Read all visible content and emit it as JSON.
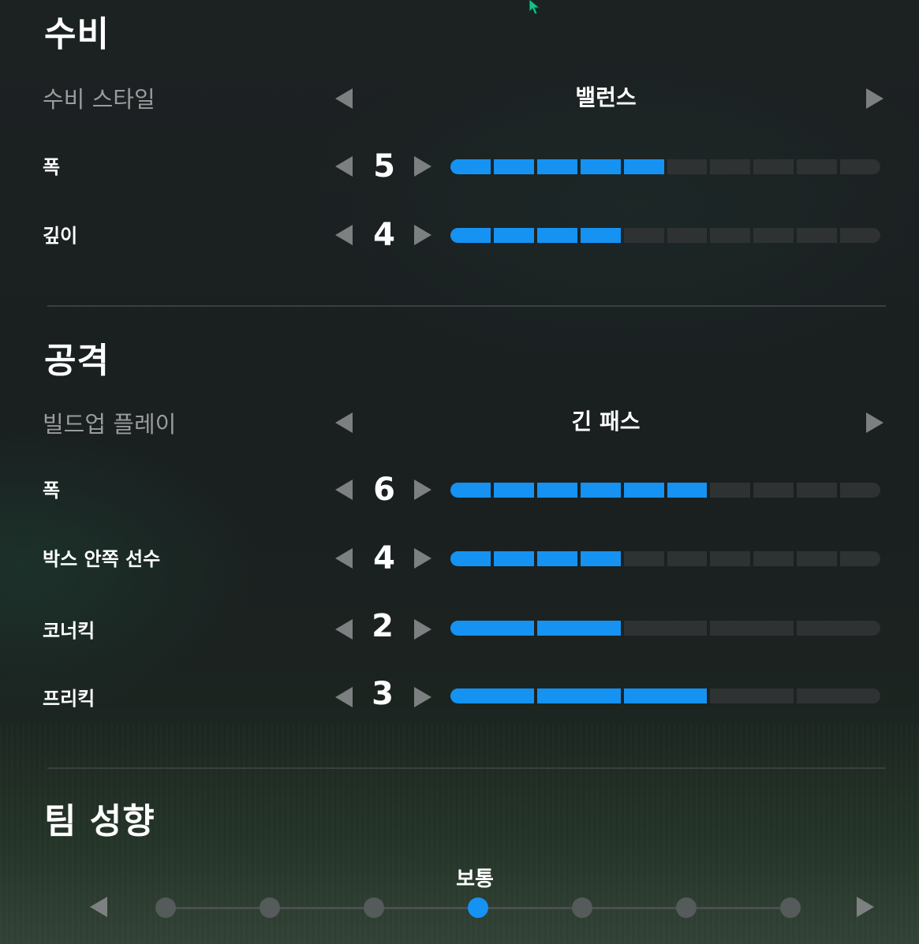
{
  "defense": {
    "title": "수비",
    "style": {
      "label": "수비 스타일",
      "value": "밸런스"
    },
    "width": {
      "label": "폭",
      "value": "5",
      "level": 5,
      "max": 10
    },
    "depth": {
      "label": "깊이",
      "value": "4",
      "level": 4,
      "max": 10
    }
  },
  "attack": {
    "title": "공격",
    "buildup": {
      "label": "빌드업 플레이",
      "value": "긴 패스"
    },
    "width": {
      "label": "폭",
      "value": "6",
      "level": 6,
      "max": 10
    },
    "box_players": {
      "label": "박스 안쪽 선수",
      "value": "4",
      "level": 4,
      "max": 10
    },
    "corner_kick": {
      "label": "코너킥",
      "value": "2",
      "level": 2,
      "max": 5
    },
    "free_kick": {
      "label": "프리킥",
      "value": "3",
      "level": 3,
      "max": 5
    }
  },
  "team_mentality": {
    "title": "팀 성향",
    "selected_label": "보통",
    "selected_index": 3,
    "steps": 7
  },
  "colors": {
    "accent": "#1592f2",
    "inactive": "#2e3232"
  },
  "icons": {
    "left": "triangle-left-icon",
    "right": "triangle-right-icon",
    "cursor": "mouse-cursor-icon"
  }
}
